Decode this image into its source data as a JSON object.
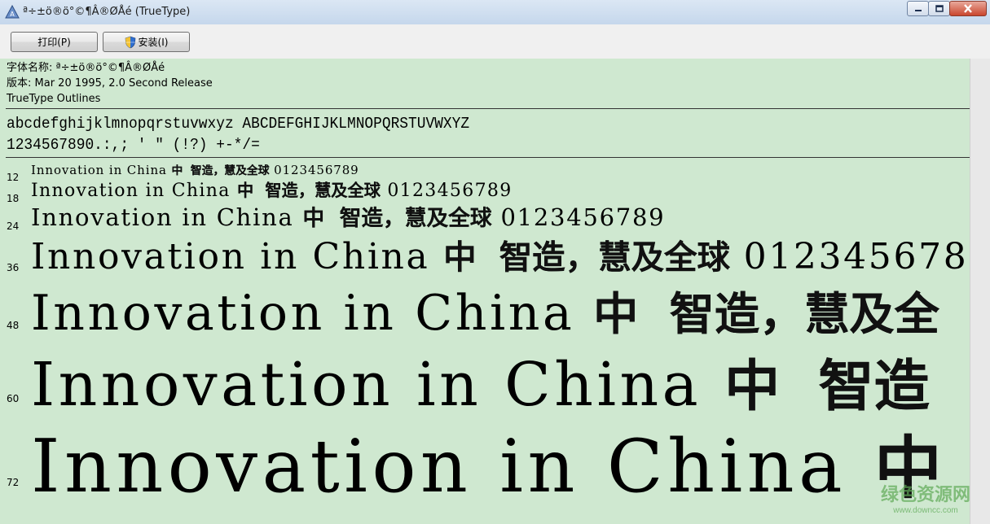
{
  "window": {
    "title": "ª÷±ö®ö°©¶Â®ØÅé (TrueType)",
    "minimize_icon": "minimize-icon",
    "maximize_icon": "maximize-icon",
    "close_icon": "close-icon"
  },
  "toolbar": {
    "print_label": "打印(P)",
    "install_label": "安装(I)",
    "install_icon": "uac-shield-icon"
  },
  "font_info": {
    "name_line": "字体名称: ª÷±ö®ö°©¶Â®ØÅé",
    "version_line": "版本: Mar 20 1995, 2.0 Second Release",
    "outline_line": "TrueType Outlines"
  },
  "charset": {
    "line1": "abcdefghijklmnopqrstuvwxyz ABCDEFGHIJKLMNOPQRSTUVWXYZ",
    "line2": "1234567890.:,; ' \" (!?) +-*/="
  },
  "samples": [
    {
      "size": "12",
      "latin": "Innovation in China",
      "cjk": "中  智造，慧及全球",
      "digits": "0123456789"
    },
    {
      "size": "18",
      "latin": "Innovation in China",
      "cjk": "中  智造，慧及全球",
      "digits": "0123456789"
    },
    {
      "size": "24",
      "latin": "Innovation in China",
      "cjk": "中  智造，慧及全球",
      "digits": "0123456789"
    },
    {
      "size": "36",
      "latin": "Innovation in China",
      "cjk": "中  智造，慧及全球",
      "digits": "012345678"
    },
    {
      "size": "48",
      "latin": "Innovation in China",
      "cjk": "中  智造，慧及全",
      "digits": ""
    },
    {
      "size": "60",
      "latin": "Innovation in China",
      "cjk": "中  智造",
      "digits": ""
    },
    {
      "size": "72",
      "latin": "Innovation in China",
      "cjk": "中",
      "digits": ""
    }
  ],
  "watermark": {
    "line1": "绿色资源网",
    "line2": "www.downcc.com"
  },
  "colors": {
    "background": "#cfe8d0",
    "watermark": "#5faa57"
  }
}
